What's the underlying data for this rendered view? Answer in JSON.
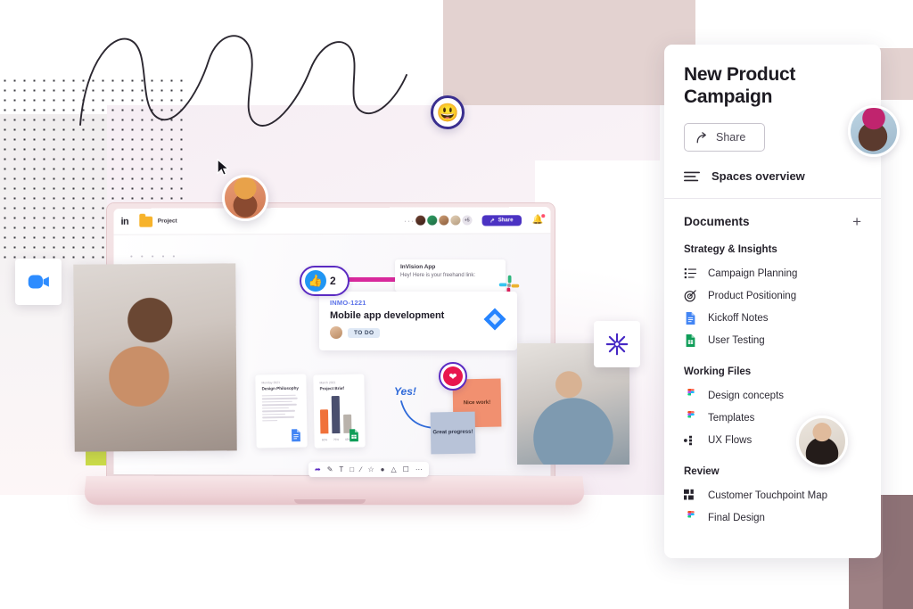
{
  "panel": {
    "title": "New Product Campaign",
    "share_label": "Share",
    "share_icon": "share-arrow-icon",
    "spaces_label": "Spaces overview",
    "spaces_icon": "lines-icon",
    "documents_label": "Documents",
    "add_label": "+",
    "groups": [
      {
        "label": "Strategy & Insights",
        "items": [
          {
            "label": "Campaign Planning",
            "icon": "checklist-icon"
          },
          {
            "label": "Product Positioning",
            "icon": "target-icon"
          },
          {
            "label": "Kickoff Notes",
            "icon": "google-docs-icon"
          },
          {
            "label": "User Testing",
            "icon": "google-sheets-icon"
          }
        ]
      },
      {
        "label": "Working Files",
        "items": [
          {
            "label": "Design concepts",
            "icon": "figma-icon"
          },
          {
            "label": "Templates",
            "icon": "figma-icon"
          },
          {
            "label": "UX Flows",
            "icon": "flow-diagram-icon"
          }
        ]
      },
      {
        "label": "Review",
        "items": [
          {
            "label": "Customer Touchpoint Map",
            "icon": "grid-blocks-icon"
          },
          {
            "label": "Final Design",
            "icon": "figma-icon"
          }
        ]
      }
    ]
  },
  "laptop": {
    "app_bar": {
      "logo": "in",
      "folder_label": "Project",
      "overflow": "···",
      "avatar_more": "+5",
      "share_label": "Share",
      "bell_icon": "bell-icon"
    },
    "like_badge": {
      "count": "2",
      "icon": "thumbs-up-icon"
    },
    "message": {
      "app_name": "InVision App",
      "text": "Hey! Here is your freehand link:",
      "app_icon": "slack-icon"
    },
    "jira_card": {
      "key": "INMO-1221",
      "title": "Mobile app development",
      "status": "TO DO",
      "app_icon": "jira-icon"
    },
    "doc_cards": [
      {
        "date": "Monday 2021",
        "title": "Design Philosophy",
        "icon": "google-docs-icon"
      },
      {
        "date": "March 2021",
        "title": "Project Brief",
        "icon": "google-sheets-icon"
      }
    ],
    "chart": {
      "labels": [
        "60%",
        "75%",
        "43%"
      ],
      "colors": [
        "#f0713a",
        "#4a4f6e",
        "#b9b2ab"
      ]
    },
    "stickies": {
      "orange": "Nice work!",
      "blue": "Great progress!",
      "annotation": "Yes!"
    },
    "heart_badge_icon": "heart-icon",
    "tools": [
      "cursor-tool",
      "pen-tool",
      "text-tool",
      "rectangle-tool",
      "line-tool",
      "comment-tool",
      "sticker-tool",
      "shape-tool",
      "frame-tool",
      "more-tools"
    ]
  },
  "decor": {
    "zoom_chip_icon": "zoom-video-icon",
    "invision_chip_icon": "invision-asterisk-icon",
    "emoji_badge": "😃",
    "photo_woman": "woman-smiling-laptop-photo",
    "photo_man": "man-with-laptop-photo",
    "avatar_orange": "avatar-headwrap",
    "avatar_panel_top": "avatar-braids",
    "avatar_panel_mid": "avatar-smiling"
  },
  "colors": {
    "brand_purple": "#5b2bc2",
    "share_blue": "#4b32c3",
    "magenta": "#d8299c",
    "accent_green": "#cbdb48",
    "pink_block": "#e3d2d0",
    "mauve_block": "#9e8184"
  }
}
